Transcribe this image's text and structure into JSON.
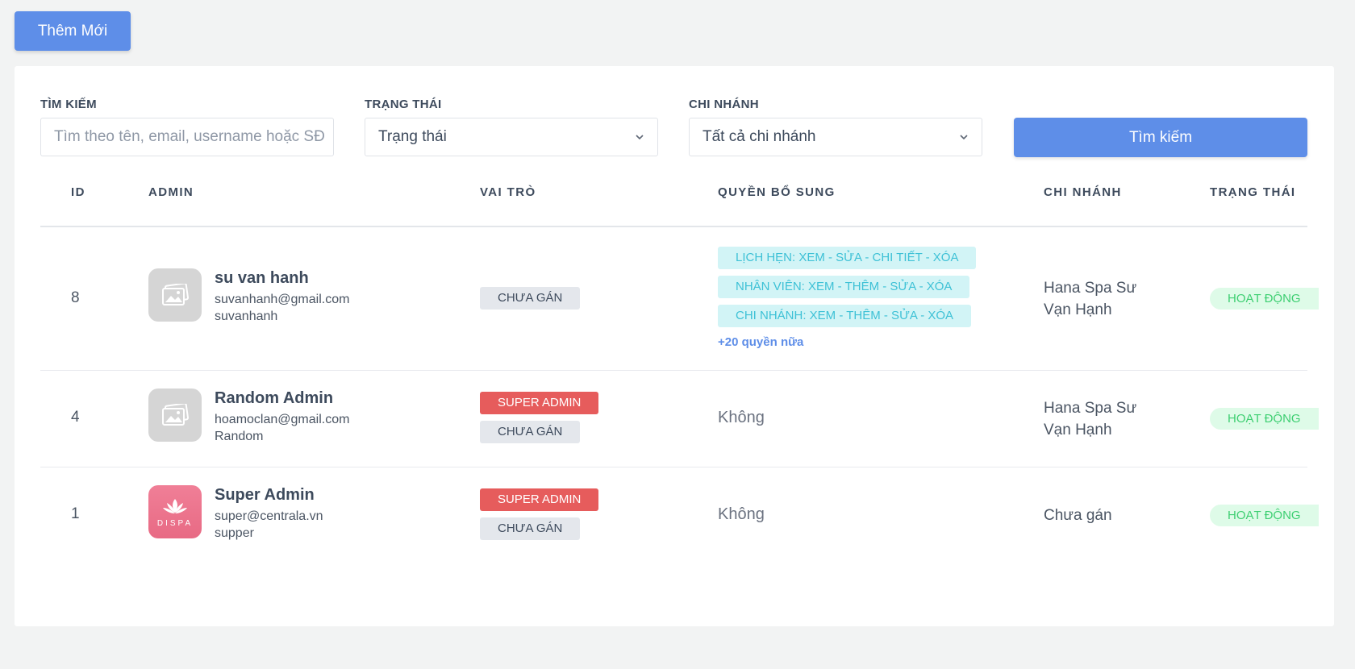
{
  "toolbar": {
    "add_label": "Thêm Mới"
  },
  "filters": {
    "search_label": "TÌM KIẾM",
    "search_placeholder": "Tìm theo tên, email, username hoặc SĐ",
    "status_label": "TRẠNG THÁI",
    "status_value": "Trạng thái",
    "branch_label": "CHI NHÁNH",
    "branch_value": "Tất cả chi nhánh",
    "search_button": "Tìm kiếm"
  },
  "table": {
    "headers": [
      "ID",
      "ADMIN",
      "VAI TRÒ",
      "QUYỀN BỔ SUNG",
      "CHI NHÁNH",
      "TRẠNG THÁI"
    ],
    "rows": [
      {
        "id": "8",
        "name": "su van hanh",
        "email": "suvanhanh@gmail.com",
        "username": "suvanhanh",
        "avatar": "placeholder-image-icon",
        "roles": [
          "CHƯA GÁN"
        ],
        "permissions": [
          "LỊCH HẸN: XEM - SỬA - CHI TIẾT - XÓA",
          "NHÂN VIÊN: XEM - THÊM - SỬA - XÓA",
          "CHI NHÁNH: XEM - THÊM - SỬA - XÓA"
        ],
        "more_permissions": "+20 quyền nữa",
        "branch": [
          "Hana Spa Sư",
          "Vạn Hạnh"
        ],
        "status": "HOẠT ĐỘNG"
      },
      {
        "id": "4",
        "name": "Random Admin",
        "email": "hoamoclan@gmail.com",
        "username": "Random",
        "avatar": "placeholder-image-icon",
        "roles": [
          "SUPER ADMIN",
          "CHƯA GÁN"
        ],
        "permissions_none": "Không",
        "branch": [
          "Hana Spa Sư",
          "Vạn Hạnh"
        ],
        "status": "HOẠT ĐỘNG"
      },
      {
        "id": "1",
        "name": "Super Admin",
        "email": "super@centrala.vn",
        "username": "supper",
        "avatar": "lotus-logo-icon",
        "avatar_text": "DISPA",
        "roles": [
          "SUPER ADMIN",
          "CHƯA GÁN"
        ],
        "permissions_none": "Không",
        "branch": [
          "Chưa gán"
        ],
        "status": "HOẠT ĐỘNG"
      }
    ]
  },
  "colors": {
    "primary": "#5e8ee8",
    "danger": "#e65c5c",
    "info_bg": "#d2f4f6",
    "info_text": "#3ec1d6",
    "success_bg": "#defbe8",
    "success_text": "#3ecf72",
    "page_bg": "#f2f3f3"
  }
}
